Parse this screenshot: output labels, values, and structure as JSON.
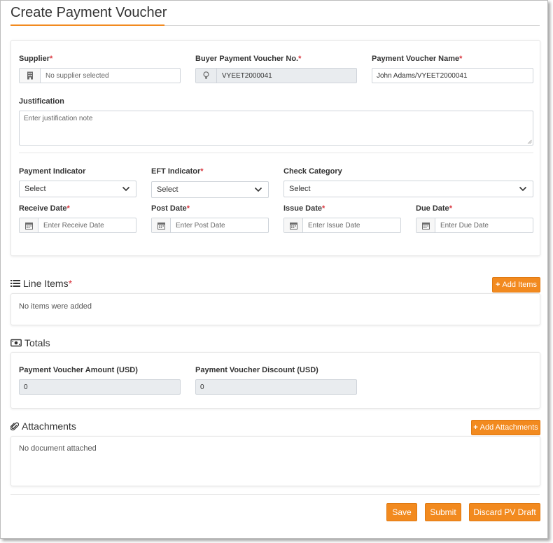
{
  "page": {
    "title": "Create Payment Voucher"
  },
  "details": {
    "supplier": {
      "label": "Supplier",
      "required": "*",
      "value": "",
      "placeholder": "No supplier selected",
      "icon": "building-icon"
    },
    "buyer_pv_no": {
      "label": "Buyer Payment Voucher No.",
      "required": "*",
      "value": "VYEET2000041",
      "icon": "lightbulb-icon"
    },
    "pv_name": {
      "label": "Payment Voucher Name",
      "required": "*",
      "value": "John Adams/VYEET2000041"
    },
    "justification": {
      "label": "Justification",
      "placeholder": "Enter justification note"
    },
    "payment_indicator": {
      "label": "Payment Indicator",
      "selected": "Select"
    },
    "eft_indicator": {
      "label": "EFT Indicator",
      "required": "*",
      "selected": "Select"
    },
    "check_category": {
      "label": "Check Category",
      "selected": "Select"
    },
    "receive_date": {
      "label": "Receive Date",
      "required": "*",
      "placeholder": "Enter Receive Date",
      "icon": "calendar-icon"
    },
    "post_date": {
      "label": "Post Date",
      "required": "*",
      "placeholder": "Enter Post Date",
      "icon": "calendar-icon"
    },
    "issue_date": {
      "label": "Issue Date",
      "required": "*",
      "placeholder": "Enter Issue Date",
      "icon": "calendar-icon"
    },
    "due_date": {
      "label": "Due Date",
      "required": "*",
      "placeholder": "Enter Due Date",
      "icon": "calendar-icon"
    }
  },
  "line_items": {
    "title": "Line Items",
    "required": "*",
    "icon": "list-icon",
    "add_label": "Add Items",
    "empty_text": "No items were added"
  },
  "totals": {
    "title": "Totals",
    "icon": "money-icon",
    "amount": {
      "label": "Payment Voucher Amount (USD)",
      "value": "0"
    },
    "discount": {
      "label": "Payment Voucher Discount (USD)",
      "value": "0"
    }
  },
  "attachments": {
    "title": "Attachments",
    "icon": "paperclip-icon",
    "add_label": "Add Attachments",
    "empty_text": "No document attached"
  },
  "actions": {
    "save": "Save",
    "submit": "Submit",
    "discard": "Discard PV Draft"
  },
  "colors": {
    "accent": "#f28a1f",
    "required": "#d9363e",
    "readonly_bg": "#e9ecef",
    "border": "#cfd4da"
  }
}
